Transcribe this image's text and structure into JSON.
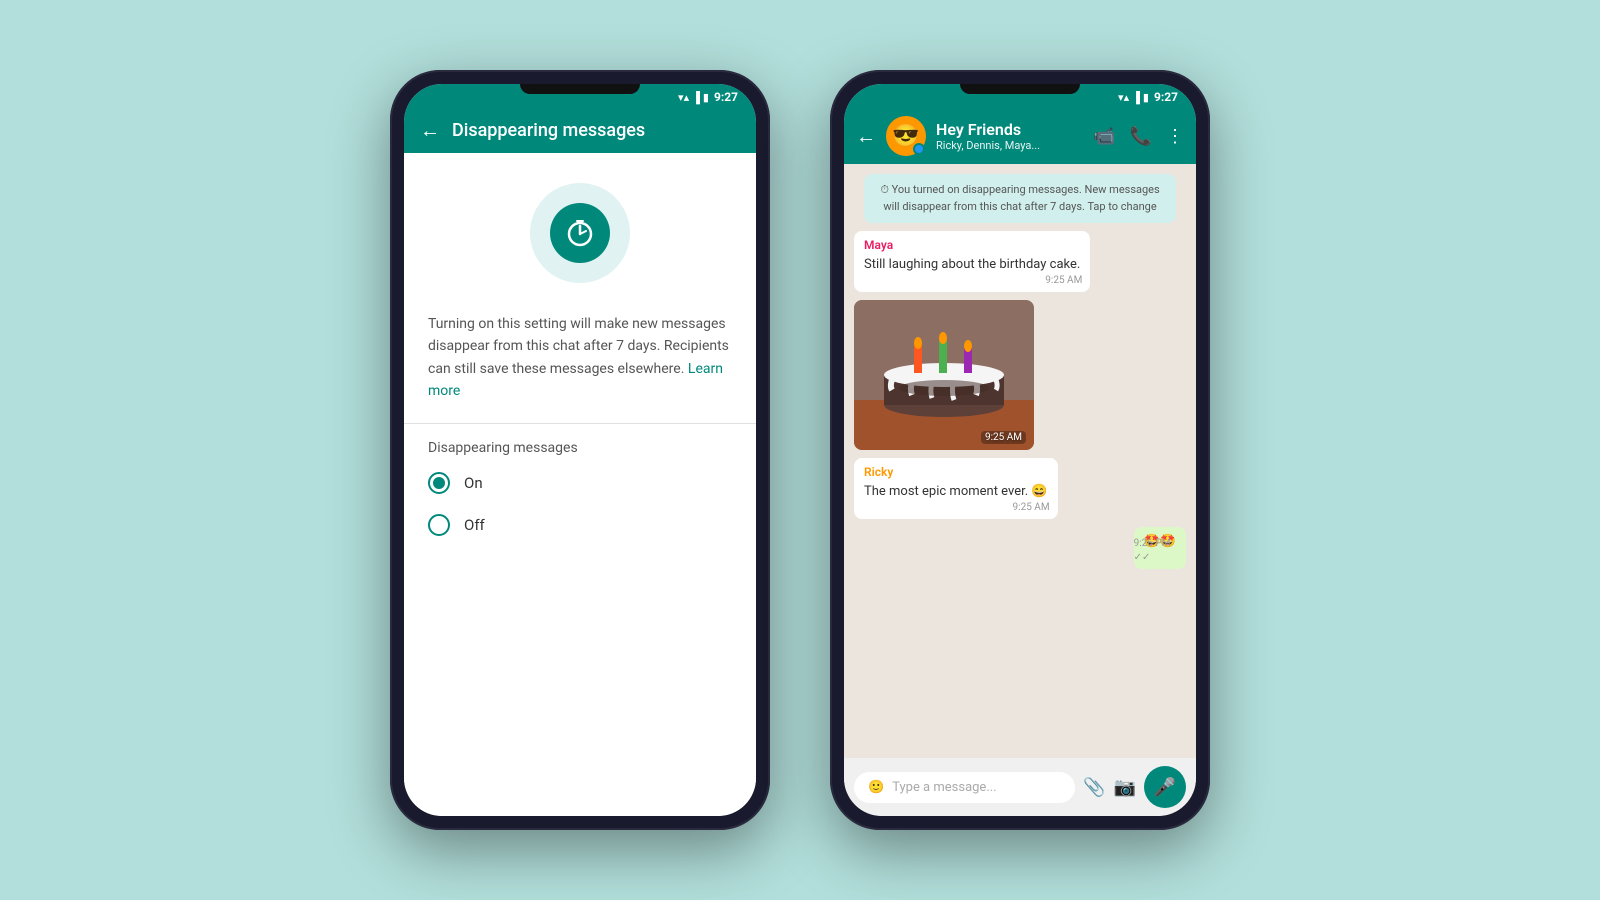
{
  "background_color": "#b2dfdb",
  "phone1": {
    "status_bar": {
      "time": "9:27"
    },
    "header": {
      "title": "Disappearing messages",
      "back_label": "←"
    },
    "description": "Turning on this setting will make new messages disappear from this chat after 7 days. Recipients can still save these messages elsewhere.",
    "learn_more": "Learn more",
    "section_title": "Disappearing messages",
    "options": [
      {
        "label": "On",
        "selected": true
      },
      {
        "label": "Off",
        "selected": false
      }
    ]
  },
  "phone2": {
    "status_bar": {
      "time": "9:27"
    },
    "header": {
      "group_name": "Hey Friends",
      "members": "Ricky, Dennis, Maya...",
      "avatar_emoji": "😎",
      "back_label": "←"
    },
    "system_message": "You turned on disappearing messages. New messages will disappear from this chat after 7 days. Tap to change",
    "messages": [
      {
        "type": "received",
        "sender": "Maya",
        "sender_color": "maya",
        "text": "Still laughing about the birthday cake.",
        "time": "9:25 AM"
      },
      {
        "type": "image",
        "time": "9:25 AM"
      },
      {
        "type": "received",
        "sender": "Ricky",
        "sender_color": "ricky",
        "text": "The most epic moment ever. 😄",
        "time": "9:25 AM"
      },
      {
        "type": "sent",
        "text": "🤩🤩",
        "time": "9:26 PM",
        "ticks": "✓✓"
      }
    ],
    "input_placeholder": "Type a message..."
  }
}
